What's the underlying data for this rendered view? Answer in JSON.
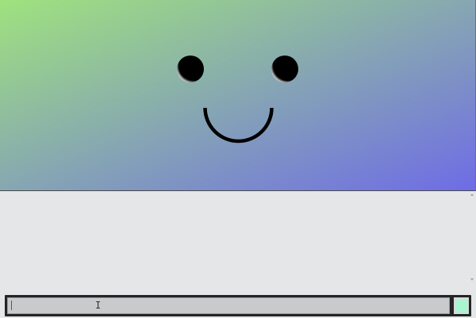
{
  "canvas": {
    "gradient_start": "#9fe27e",
    "gradient_end": "#6e6ce6",
    "face": {
      "eye_color": "#000000",
      "mouth_color": "#000000"
    }
  },
  "console": {
    "log_text": ""
  },
  "input": {
    "value": "",
    "cursor_glyph": "I",
    "swatch_color": "#a8f5d0",
    "swatch_border": "#d8dadc"
  }
}
